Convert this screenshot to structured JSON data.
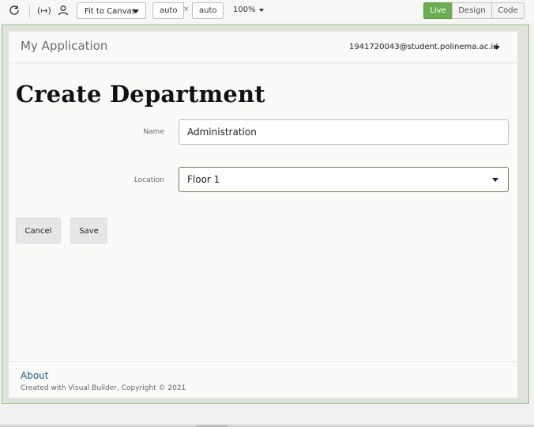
{
  "toolbar": {
    "refresh_icon": "refresh-icon",
    "variables_icon": "variables-icon",
    "user_icon": "user-icon",
    "fit_label": "Fit to Canvas",
    "width_value": "auto",
    "height_value": "auto",
    "times_symbol": "×",
    "zoom_label": "100%",
    "modes": {
      "live": "Live",
      "design": "Design",
      "code": "Code"
    }
  },
  "app": {
    "title": "My Application",
    "user_email": "1941720043@student.polinema.ac.id",
    "page_title": "Create Department",
    "form": {
      "name_label": "Name",
      "name_value": "Administration",
      "location_label": "Location",
      "location_value": "Floor 1"
    },
    "buttons": {
      "cancel": "Cancel",
      "save": "Save"
    },
    "footer": {
      "about": "About",
      "copyright": "Created with Visual Builder, Copyright © 2021"
    }
  },
  "colors": {
    "accent": "#6cad54",
    "select_border": "#5f7f52",
    "link": "#1b5e8c"
  }
}
